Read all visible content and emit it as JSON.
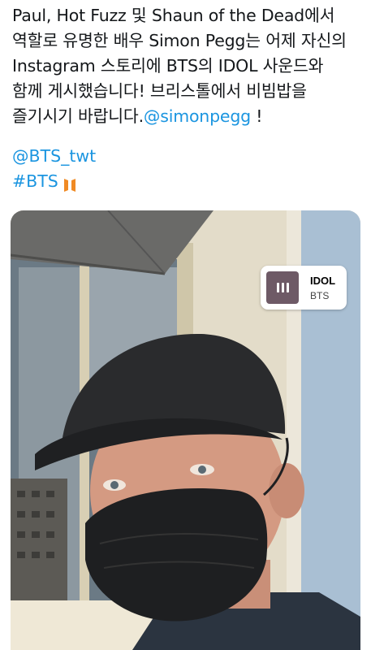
{
  "tweet": {
    "line1": "Paul, Hot Fuzz 및 Shaun of the Dead에서",
    "line2": "역할로 유명한 배우 Simon Pegg는 어제 자신의",
    "line3": "Instagram 스토리에 BTS의 IDOL 사운드와",
    "line4": "함께 게시했습니다! 브리스톨에서 비빔밥을",
    "line5": "즐기시기 바랍니다.",
    "mention_inline": "@simonpegg",
    "after_mention": " !",
    "mention_account": "@BTS_twt",
    "hashtag": "#BTS"
  },
  "sticker": {
    "song_title": "IDOL",
    "artist": "BTS",
    "art_color": "#6e5a66"
  },
  "colors": {
    "link": "#1b95e0",
    "text": "#14171a",
    "bts_logo": "#f08a24"
  }
}
